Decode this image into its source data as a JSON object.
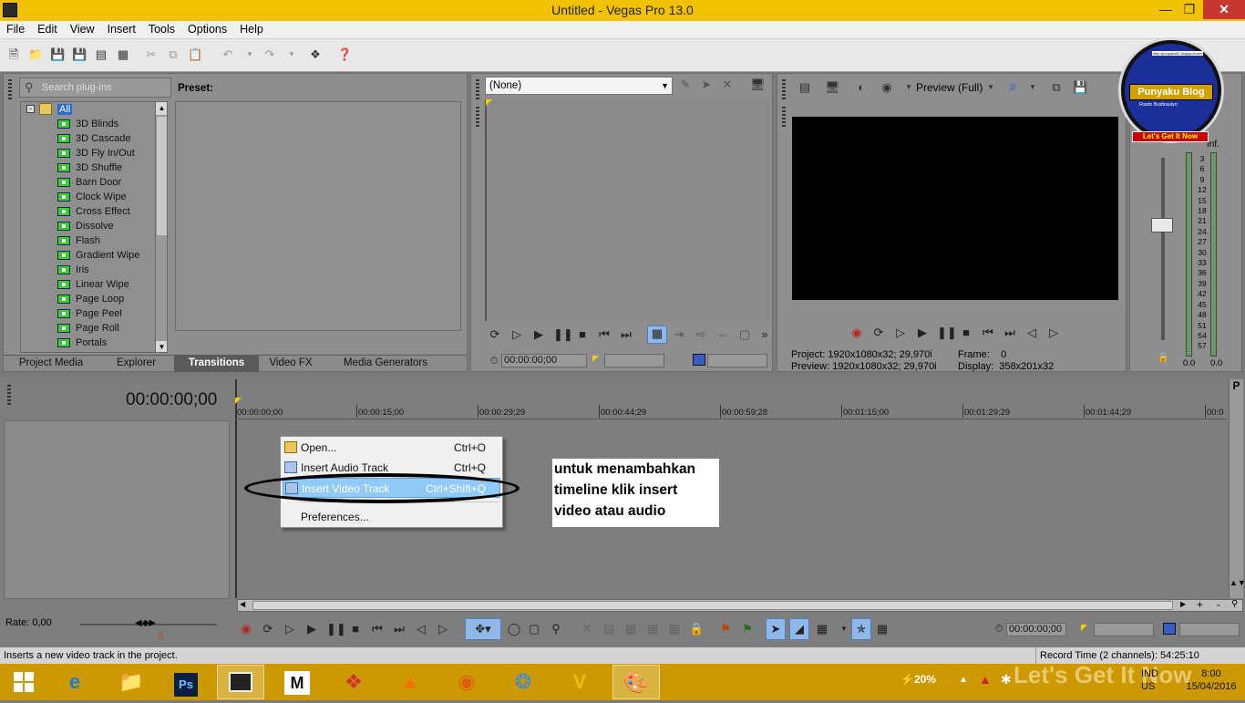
{
  "window": {
    "title": "Untitled - Vegas Pro 13.0"
  },
  "menu": [
    "File",
    "Edit",
    "View",
    "Insert",
    "Tools",
    "Options",
    "Help"
  ],
  "plugins": {
    "search_placeholder": "Search plug-ins",
    "preset_label": "Preset:",
    "root": "All",
    "items": [
      "3D Blinds",
      "3D Cascade",
      "3D Fly In/Out",
      "3D Shuffle",
      "Barn Door",
      "Clock Wipe",
      "Cross Effect",
      "Dissolve",
      "Flash",
      "Gradient Wipe",
      "Iris",
      "Linear Wipe",
      "Page Loop",
      "Page Peel",
      "Page Roll",
      "Portals"
    ]
  },
  "tabs": [
    "Project Media",
    "Explorer",
    "Transitions",
    "Video FX",
    "Media Generators"
  ],
  "trimmer": {
    "dropdown_value": "(None)",
    "timecode": "00:00:00;00"
  },
  "preview": {
    "mode": "Preview (Full)",
    "project_label": "Project:",
    "project_value": "1920x1080x32; 29,970i",
    "preview_label": "Preview:",
    "preview_value": "1920x1080x32; 29,970i",
    "frame_label": "Frame:",
    "frame_value": "0",
    "display_label": "Display:",
    "display_value": "358x201x32"
  },
  "meter": {
    "top": "Inf.",
    "scale": [
      "3",
      "6",
      "9",
      "12",
      "15",
      "18",
      "21",
      "24",
      "27",
      "30",
      "33",
      "36",
      "39",
      "42",
      "45",
      "48",
      "51",
      "54",
      "57"
    ],
    "left_val": "0.0",
    "right_val": "0.0"
  },
  "timeline": {
    "timecode": "00:00:00;00",
    "ruler": [
      "00:00:00;00",
      "00:00:15;00",
      "00:00:29;29",
      "00:00:44;29",
      "00:00:59;28",
      "00:01:15;00",
      "00:01:29;29",
      "00:01:44;29",
      "00:0"
    ],
    "rate": "Rate: 0,00",
    "bottom_timecode": "00:00:00;00"
  },
  "context_menu": [
    {
      "label": "Open...",
      "shortcut": "Ctrl+O"
    },
    {
      "label": "Insert Audio Track",
      "shortcut": "Ctrl+Q"
    },
    {
      "label": "Insert Video Track",
      "shortcut": "Ctrl+Shift+Q"
    },
    {
      "label": "Preferences...",
      "shortcut": ""
    }
  ],
  "annotation": {
    "line1": "untuk menambahkan",
    "line2": "timeline klik insert",
    "line3": "video atau audio"
  },
  "logo": {
    "name": "Punyaku Blog",
    "sub": "Rasto Budiraulyo",
    "slogan": "Let's Get It Now",
    "url": "http://punyaku87.blogspot.com"
  },
  "status": {
    "hint": "Inserts a new video track in the project.",
    "record_time": "Record Time (2 channels): 54:25:10"
  },
  "taskbar": {
    "battery": "20%",
    "lang1": "IND",
    "lang2": "US",
    "time": "8:00",
    "date": "15/04/2016",
    "watermark": "Let's Get It Now"
  },
  "colors": {
    "titlebar": "#f2c200",
    "taskbar": "#cc9a00",
    "highlight": "#91c9f7",
    "close": "#c7372f"
  }
}
